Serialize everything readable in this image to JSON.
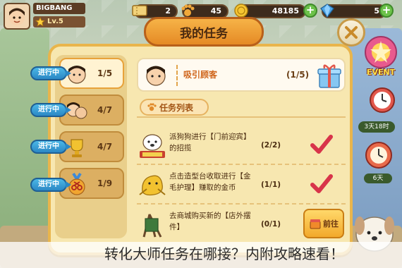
{
  "player": {
    "name": "BIGBANG",
    "level": "Lv.5"
  },
  "hud": {
    "ticket_count": "2",
    "paw_count": "45",
    "coins": "48185",
    "gems": "5",
    "plus": "+"
  },
  "event": {
    "label": "EVENT",
    "timer": "3天18时",
    "days": "6天"
  },
  "panel": {
    "title": "我的任务",
    "close": "✕"
  },
  "tabs": [
    {
      "status": "进行中",
      "count": "1/5",
      "icon": "customer-avatar-icon"
    },
    {
      "status": "进行中",
      "count": "4/7",
      "icon": "family-avatar-icon"
    },
    {
      "status": "进行中",
      "count": "4/7",
      "icon": "trophy-icon"
    },
    {
      "status": "进行中",
      "count": "1/9",
      "icon": "scissors-medal-icon"
    }
  ],
  "header": {
    "name": "吸引顾客",
    "count": "(1/5)",
    "icon": "gift-box-icon"
  },
  "section": {
    "label": "任务列表"
  },
  "tasks": [
    {
      "text": "派狗狗进行【门前迎宾】的招揽",
      "progress": "(2/2)",
      "done": true,
      "icon": "welcome-dog-icon"
    },
    {
      "text": "点击造型台收取进行【金毛护理】赚取的金币",
      "progress": "(1/1)",
      "done": true,
      "icon": "golden-dog-icon"
    },
    {
      "text": "去商城购买新的【店外摆件】",
      "progress": "(0/1)",
      "done": false,
      "icon": "signboard-icon",
      "go_label": "前往"
    }
  ],
  "caption": "转化大师任务在哪接？内附攻略速看！",
  "colors": {
    "accent": "#e9b54c",
    "status_blue": "#2b88c5",
    "check_red": "#d8344a"
  }
}
